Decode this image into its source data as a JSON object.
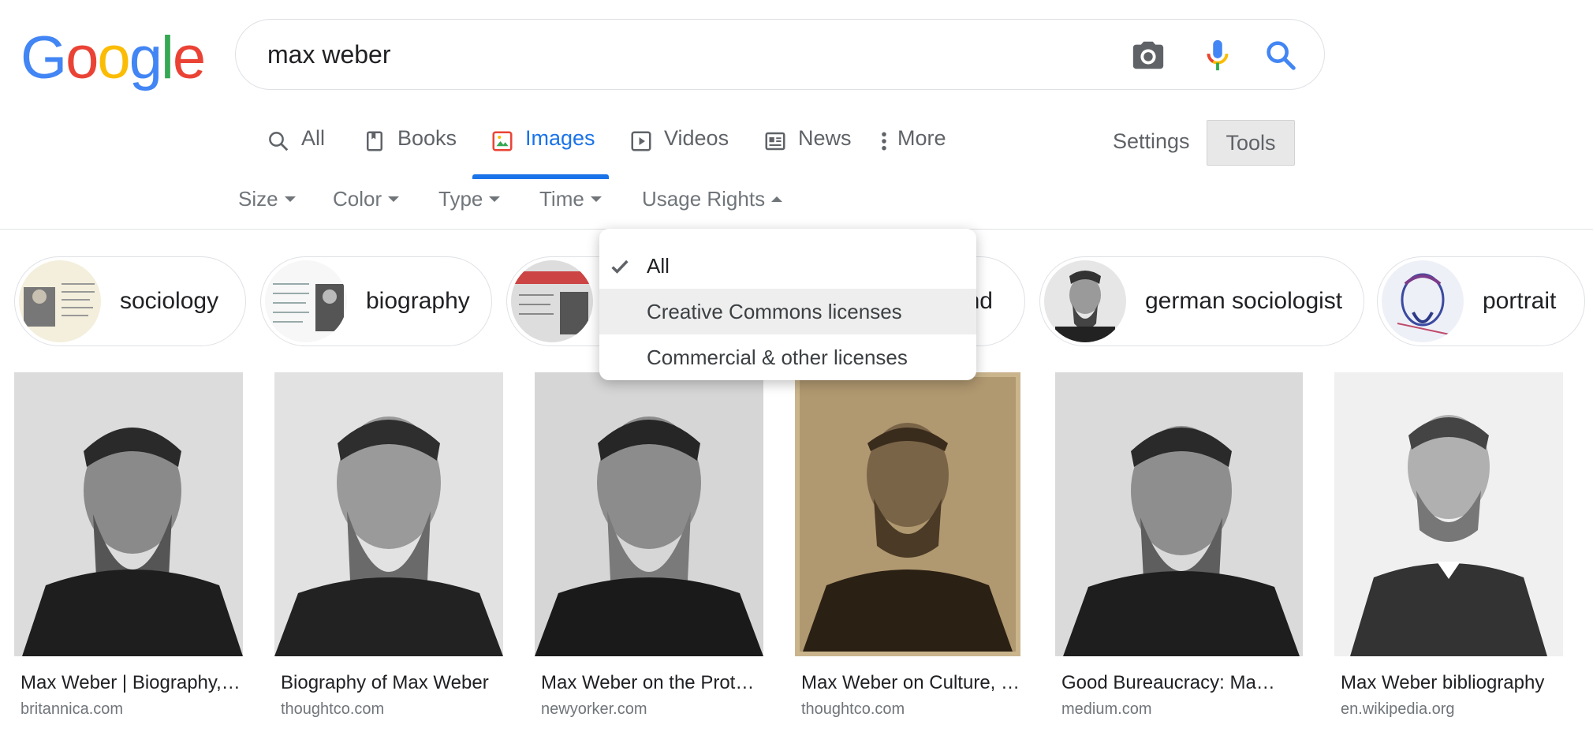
{
  "logo": {
    "letters": [
      "G",
      "o",
      "o",
      "g",
      "l",
      "e"
    ],
    "colors": [
      "#4285f4",
      "#ea4335",
      "#fbbc05",
      "#4285f4",
      "#34a853",
      "#ea4335"
    ]
  },
  "search": {
    "query": "max weber"
  },
  "tabs": [
    {
      "label": "All",
      "icon": "search-icon"
    },
    {
      "label": "Books",
      "icon": "book-icon"
    },
    {
      "label": "Images",
      "icon": "image-icon"
    },
    {
      "label": "Videos",
      "icon": "play-icon"
    },
    {
      "label": "News",
      "icon": "news-icon"
    },
    {
      "label": "More",
      "icon": "more-icon"
    }
  ],
  "settings_label": "Settings",
  "tools_label": "Tools",
  "filters": [
    "Size",
    "Color",
    "Type",
    "Time",
    "Usage Rights"
  ],
  "chips": [
    {
      "label": "sociology"
    },
    {
      "label": "biography"
    },
    {
      "label": ""
    },
    {
      "label": "nd"
    },
    {
      "label": "german sociologist"
    },
    {
      "label": "portrait"
    }
  ],
  "usage_dropdown": {
    "items": [
      {
        "label": "All",
        "selected": true
      },
      {
        "label": "Creative Commons licenses",
        "selected": false
      },
      {
        "label": "Commercial & other licenses",
        "selected": false
      }
    ]
  },
  "results": [
    {
      "title": "Max Weber | Biography, Books, Sociology",
      "source": "britannica.com"
    },
    {
      "title": "Biography of Max Weber",
      "source": "thoughtco.com"
    },
    {
      "title": "Max Weber on the Protestant Ethic",
      "source": "newyorker.com"
    },
    {
      "title": "Max Weber on Culture, Society",
      "source": "thoughtco.com"
    },
    {
      "title": "Good Bureaucracy: Max Weber",
      "source": "medium.com"
    },
    {
      "title": "Max Weber bibliography",
      "source": "en.wikipedia.org"
    }
  ],
  "colors": {
    "accent": "#1a73e8",
    "text": "#202124",
    "muted": "#70757a"
  }
}
